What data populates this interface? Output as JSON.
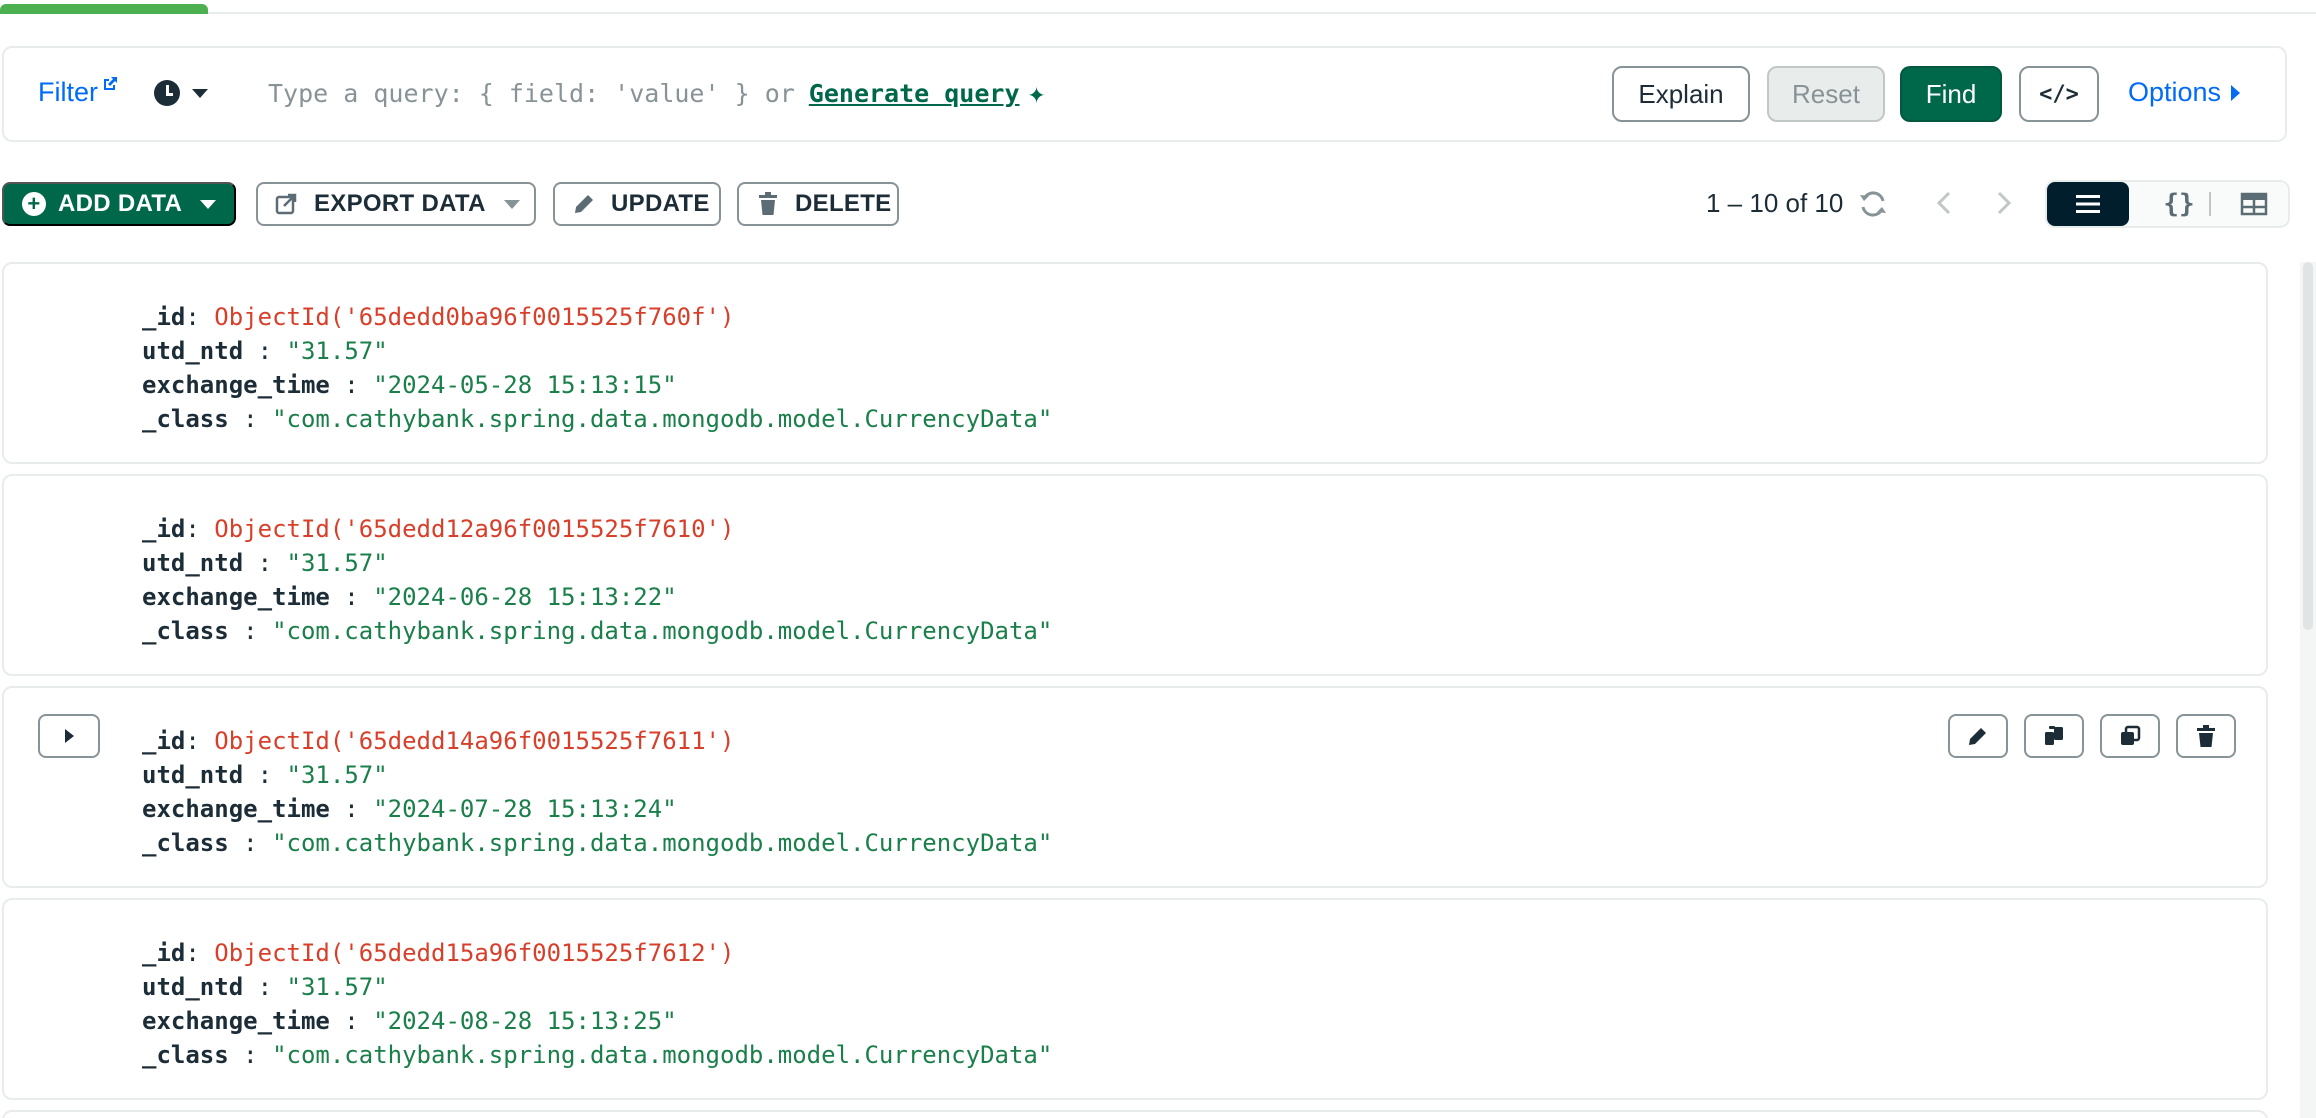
{
  "query_bar": {
    "filter_label": "Filter",
    "placeholder": "Type a query: { field: 'value' } or",
    "generate_label": "Generate query",
    "spark_glyph": "✦",
    "explain_label": "Explain",
    "reset_label": "Reset",
    "find_label": "Find",
    "code_label": "</>",
    "options_label": "Options"
  },
  "toolbar": {
    "add_data_label": "ADD DATA",
    "export_data_label": "EXPORT DATA",
    "update_label": "UPDATE",
    "delete_label": "DELETE",
    "pagination": "1 – 10 of 10",
    "json_view_label": "{}"
  },
  "documents": [
    {
      "id_key": "_id",
      "id_value": "ObjectId('65dedd0ba96f0015525f760f')",
      "utd_key": "utd_ntd",
      "utd_value": "\"31.57\"",
      "time_key": "exchange_time",
      "time_value": "\"2024-05-28 15:13:15\"",
      "class_key": "_class",
      "class_value": "\"com.cathybank.spring.data.mongodb.model.CurrencyData\""
    },
    {
      "id_key": "_id",
      "id_value": "ObjectId('65dedd12a96f0015525f7610')",
      "utd_key": "utd_ntd",
      "utd_value": "\"31.57\"",
      "time_key": "exchange_time",
      "time_value": "\"2024-06-28 15:13:22\"",
      "class_key": "_class",
      "class_value": "\"com.cathybank.spring.data.mongodb.model.CurrencyData\""
    },
    {
      "id_key": "_id",
      "id_value": "ObjectId('65dedd14a96f0015525f7611')",
      "utd_key": "utd_ntd",
      "utd_value": "\"31.57\"",
      "time_key": "exchange_time",
      "time_value": "\"2024-07-28 15:13:24\"",
      "class_key": "_class",
      "class_value": "\"com.cathybank.spring.data.mongodb.model.CurrencyData\""
    },
    {
      "id_key": "_id",
      "id_value": "ObjectId('65dedd15a96f0015525f7612')",
      "utd_key": "utd_ntd",
      "utd_value": "\"31.57\"",
      "time_key": "exchange_time",
      "time_value": "\"2024-08-28 15:13:25\"",
      "class_key": "_class",
      "class_value": "\"com.cathybank.spring.data.mongodb.model.CurrencyData\""
    }
  ],
  "colors": {
    "primary_green": "#00684a",
    "link_blue": "#016bf8",
    "object_id_red": "#d83f2a",
    "string_green": "#1a7f4a",
    "dark": "#001e2b",
    "tab_accent": "#4caf50"
  },
  "icons": {
    "filter_external": "external-link-icon",
    "history": "clock-icon",
    "generate": "sparkle-icon",
    "add": "plus-circle-icon",
    "export": "export-icon",
    "update": "pencil-icon",
    "delete": "trash-icon",
    "refresh": "refresh-icon",
    "prev": "chevron-left-icon",
    "next": "chevron-right-icon",
    "list_view": "list-icon",
    "table_view": "table-icon",
    "expand": "triangle-right-icon",
    "edit": "pencil-icon",
    "copy": "copy-icon",
    "clone": "clone-icon",
    "remove": "trash-icon"
  }
}
